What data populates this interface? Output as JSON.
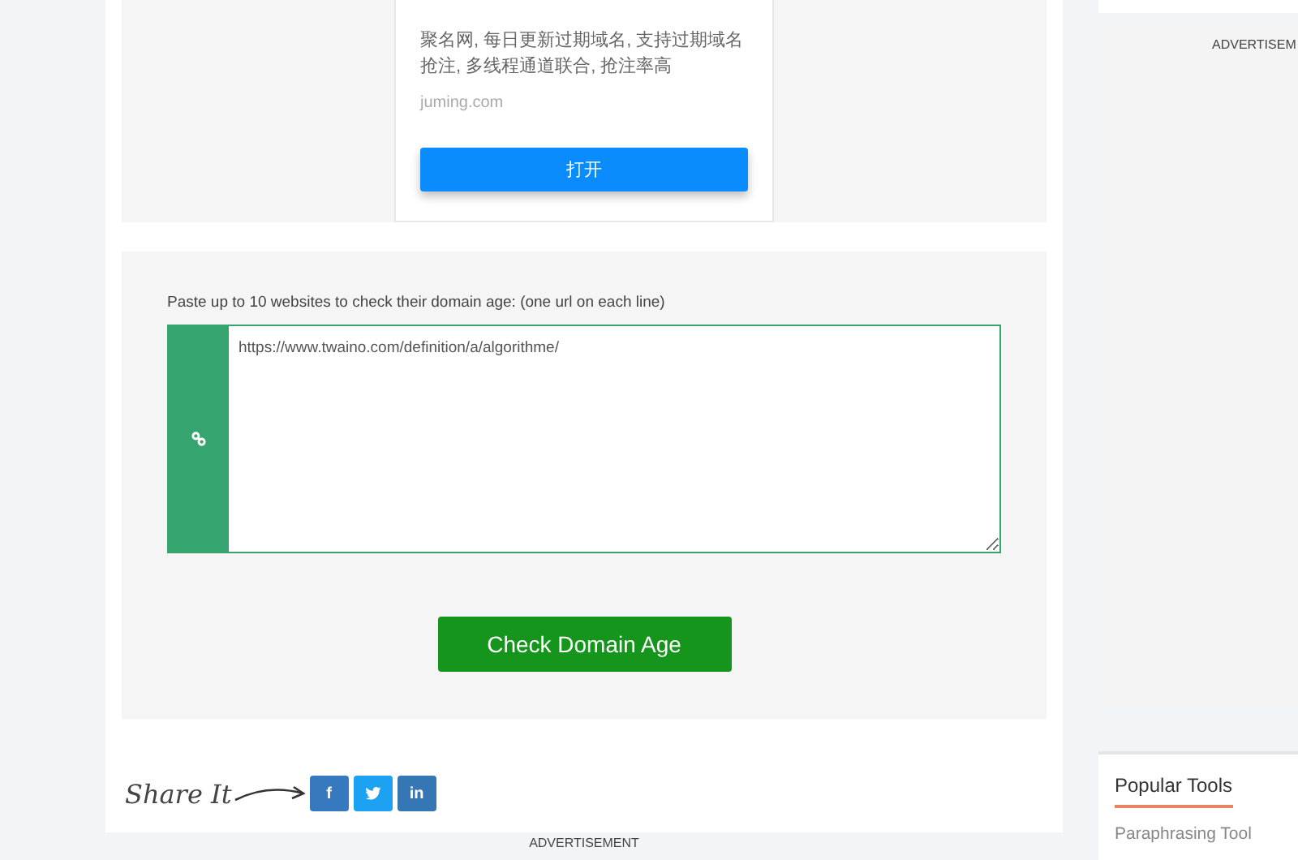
{
  "promo_card": {
    "description": "聚名网, 每日更新过期域名, 支持过期域名抢注, 多线程通道联合, 抢注率高",
    "domain": "juming.com",
    "button": "打开"
  },
  "checker": {
    "label": "Paste up to 10 websites to check their domain age: (one url on each line)",
    "value": "https://www.twaino.com/definition/a/algorithme/",
    "button": "Check Domain Age"
  },
  "share": {
    "label": "Share It",
    "buttons": [
      {
        "kind": "facebook",
        "text": "f"
      },
      {
        "kind": "twitter"
      },
      {
        "kind": "linkedin",
        "text": "in"
      }
    ]
  },
  "bottom_ad": "ADVERTISEMENT",
  "sidebar": {
    "ad": "ADVERTISEM",
    "popular_tools": {
      "title": "Popular Tools",
      "items": [
        "Paraphrasing Tool"
      ]
    }
  }
}
